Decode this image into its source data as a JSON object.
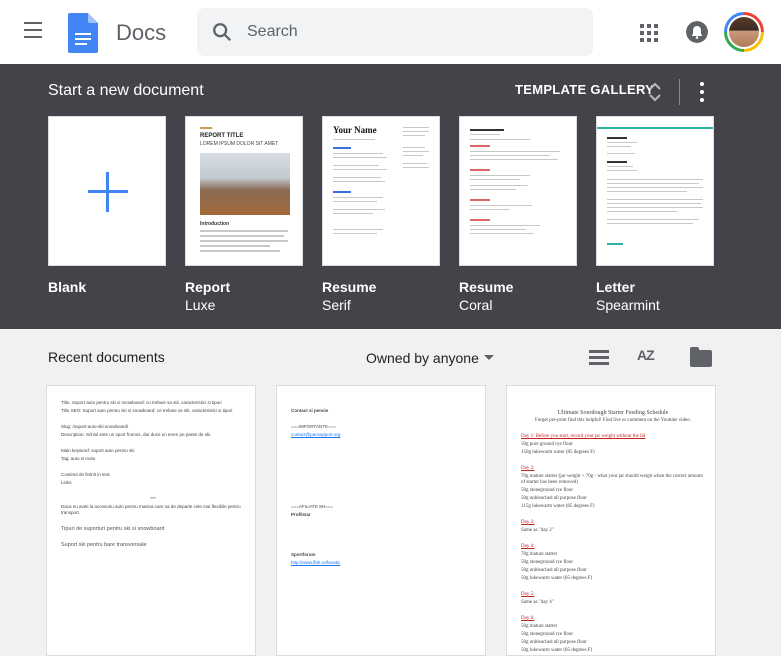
{
  "header": {
    "app_title": "Docs",
    "search_placeholder": "Search"
  },
  "templates": {
    "section_title": "Start a new document",
    "gallery_label": "TEMPLATE GALLERY",
    "items": [
      {
        "name": "Blank",
        "subtitle": ""
      },
      {
        "name": "Report",
        "subtitle": "Luxe"
      },
      {
        "name": "Resume",
        "subtitle": "Serif"
      },
      {
        "name": "Resume",
        "subtitle": "Coral"
      },
      {
        "name": "Letter",
        "subtitle": "Spearmint"
      }
    ],
    "report_title": "REPORT TITLE",
    "report_subtitle": "LOREM IPSUM DOLOR SIT AMET",
    "report_intro": "Introduction",
    "resume_name": "Your Name"
  },
  "recent": {
    "section_title": "Recent documents",
    "owner_filter": "Owned by anyone",
    "sort_label": "AZ",
    "doc1": {
      "line1": "Titlu: Suport auto pentru ski si snowboard: cu trebuie sa stii, caracteristici si tipuri",
      "line2": "Titlu SEO: Suport auto pentru ski si snowboard: ce trebuie sa stii, caracteristici si tipuri",
      "slug": "Slug: /suport-auto-ski-snowboard/",
      "description": "Description: Schiul este un sport frumos, dar duce un teren pe pante de ski.",
      "keyword": "Main keyword: suport auto pentru ski",
      "tag": "Tag: auto si moto",
      "links_head": "Continut de fintnit in text:",
      "links": "Links",
      "sep": "***",
      "para1": "Daca nu aveti la accesoriu auto pentru masina care sa de departe cele mai flexibile pentru transport.",
      "heading1": "Tipuri de suporturi pentru ski si snowboard",
      "heading2": "Suport ski pentru bare transversale"
    },
    "doc2": {
      "title": "Contact si pensie",
      "h1": "===IMPORTANTE===",
      "h2": "===AFILIATE 8H===",
      "h3": "Profilstar",
      "h4": "Sportforum",
      "link1": "contact@pansupport.org",
      "link2": "http://www.ffah.ro/fanatic"
    },
    "doc3": {
      "title": "Ultimate Sourdough Starter Feeding Schedule",
      "intro": "Forget pre-print find this helpful! Find live or comment on the Youtube video.",
      "day1": "Day 1: Before you start, record your jar weight without the lid",
      "day1_lines": [
        "50g pure ground rye flour",
        "150g lukewarm water (85 degrees F)"
      ],
      "day2": "Day 2:",
      "day2_lines": [
        "70g mature starter (jar weight + 70g - what your jar should weigh when the correct amount of starter has been removed)",
        "50g stoneground rye flour",
        "50g unbleached all purpose flour",
        "115g lukewarm water (85 degrees F)"
      ],
      "day3": "Day 3:",
      "day3_lines": [
        "Same as \"day 2\""
      ],
      "day4": "Day 4:",
      "day4_lines": [
        "70g mature starter",
        "50g stoneground rye flour",
        "50g unbleached all purpose flour",
        "50g lukewarm water (85 degrees F)"
      ],
      "day5": "Day 5:",
      "day5_lines": [
        "Same as \"day 4\""
      ],
      "day6": "Day 6:",
      "day6_lines": [
        "50g mature starter",
        "50g stoneground rye flour",
        "50g unbleached all purpose flour",
        "50g lukewarm water (85 degrees F)"
      ]
    }
  },
  "colors": {
    "header_bg": "#ffffff",
    "template_bg": "#444349",
    "page_bg": "#f1f1f1",
    "accent": "#4285f4"
  }
}
